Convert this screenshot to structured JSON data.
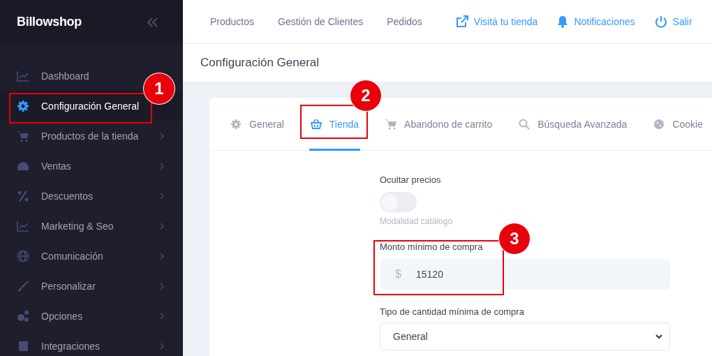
{
  "sidebar": {
    "brand": "Billowshop",
    "items": [
      {
        "label": "Dashboard",
        "selected": false,
        "expandable": false
      },
      {
        "label": "Configuración General",
        "selected": true,
        "expandable": false
      },
      {
        "label": "Productos de la tienda",
        "selected": false,
        "expandable": true
      },
      {
        "label": "Ventas",
        "selected": false,
        "expandable": true
      },
      {
        "label": "Descuentos",
        "selected": false,
        "expandable": true
      },
      {
        "label": "Marketing & Seo",
        "selected": false,
        "expandable": true
      },
      {
        "label": "Comunicación",
        "selected": false,
        "expandable": true
      },
      {
        "label": "Personalizar",
        "selected": false,
        "expandable": true
      },
      {
        "label": "Opciones",
        "selected": false,
        "expandable": true
      },
      {
        "label": "Integraciones",
        "selected": false,
        "expandable": true
      }
    ]
  },
  "topbar": {
    "links": [
      "Productos",
      "Gestión de Clientes",
      "Pedidos"
    ],
    "actions": [
      "Visitá tu tienda",
      "Notificaciones",
      "Salir"
    ]
  },
  "page_title": "Configuración General",
  "tabs": [
    {
      "label": "General",
      "selected": false
    },
    {
      "label": "Tienda",
      "selected": true
    },
    {
      "label": "Abandono de carrito",
      "selected": false
    },
    {
      "label": "Búsqueda Avanzada",
      "selected": false
    },
    {
      "label": "Cookie",
      "selected": false
    }
  ],
  "form": {
    "hide_prices": {
      "label": "Ocultar precios",
      "on": false,
      "hint": "Modalidad catálogo"
    },
    "min_amount": {
      "label": "Monto mínimo de compra",
      "prefix": "$",
      "value": "15120"
    },
    "min_qty_type": {
      "label": "Tipo de cantidad mínima de compra",
      "value": "General"
    }
  },
  "annotations": [
    {
      "number": "1"
    },
    {
      "number": "2"
    },
    {
      "number": "3"
    }
  ]
}
